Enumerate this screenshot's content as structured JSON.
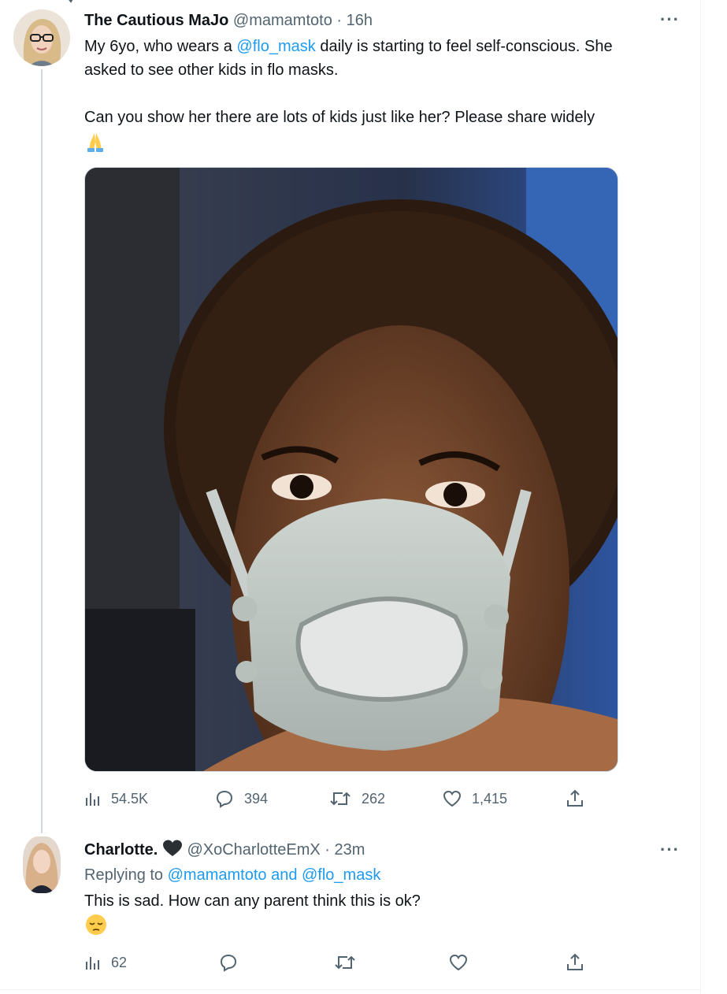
{
  "tweet": {
    "author_name": "The Cautious MaJo",
    "handle": "@mamamtoto",
    "separator": "·",
    "time": "16h",
    "more_label": "···",
    "text_line1_pre": "My 6yo, who wears a ",
    "mention": "@flo_mask",
    "text_line1_post": " daily is starting to feel self-conscious. She",
    "text_line2": "asked to see other kids in flo masks.",
    "text_line3": "Can you show her there are lots of kids just like her? Please share widely",
    "emoji": "folded-hands",
    "stats": {
      "views": "54.5K",
      "replies": "394",
      "retweets": "262",
      "likes": "1,415"
    }
  },
  "reply": {
    "author_name": "Charlotte.",
    "name_emoji": "black-heart",
    "handle": "@XoCharlotteEmX",
    "separator": "·",
    "time": "23m",
    "more_label": "···",
    "replying_to_prefix": "Replying to ",
    "replying_to_users": "@mamamtoto and @flo_mask",
    "text": "This is sad.  How can any parent think this is ok?",
    "emoji": "pensive-face",
    "stats": {
      "views": "62"
    }
  },
  "icons": {
    "views": "bar-chart-icon",
    "reply": "speech-bubble-icon",
    "retweet": "retweet-icon",
    "like": "heart-icon",
    "share": "share-icon",
    "more": "more-icon"
  },
  "colors": {
    "link": "#1d9bf0",
    "muted": "#536471",
    "text": "#0f1419",
    "thread_line": "#cfd9de"
  }
}
